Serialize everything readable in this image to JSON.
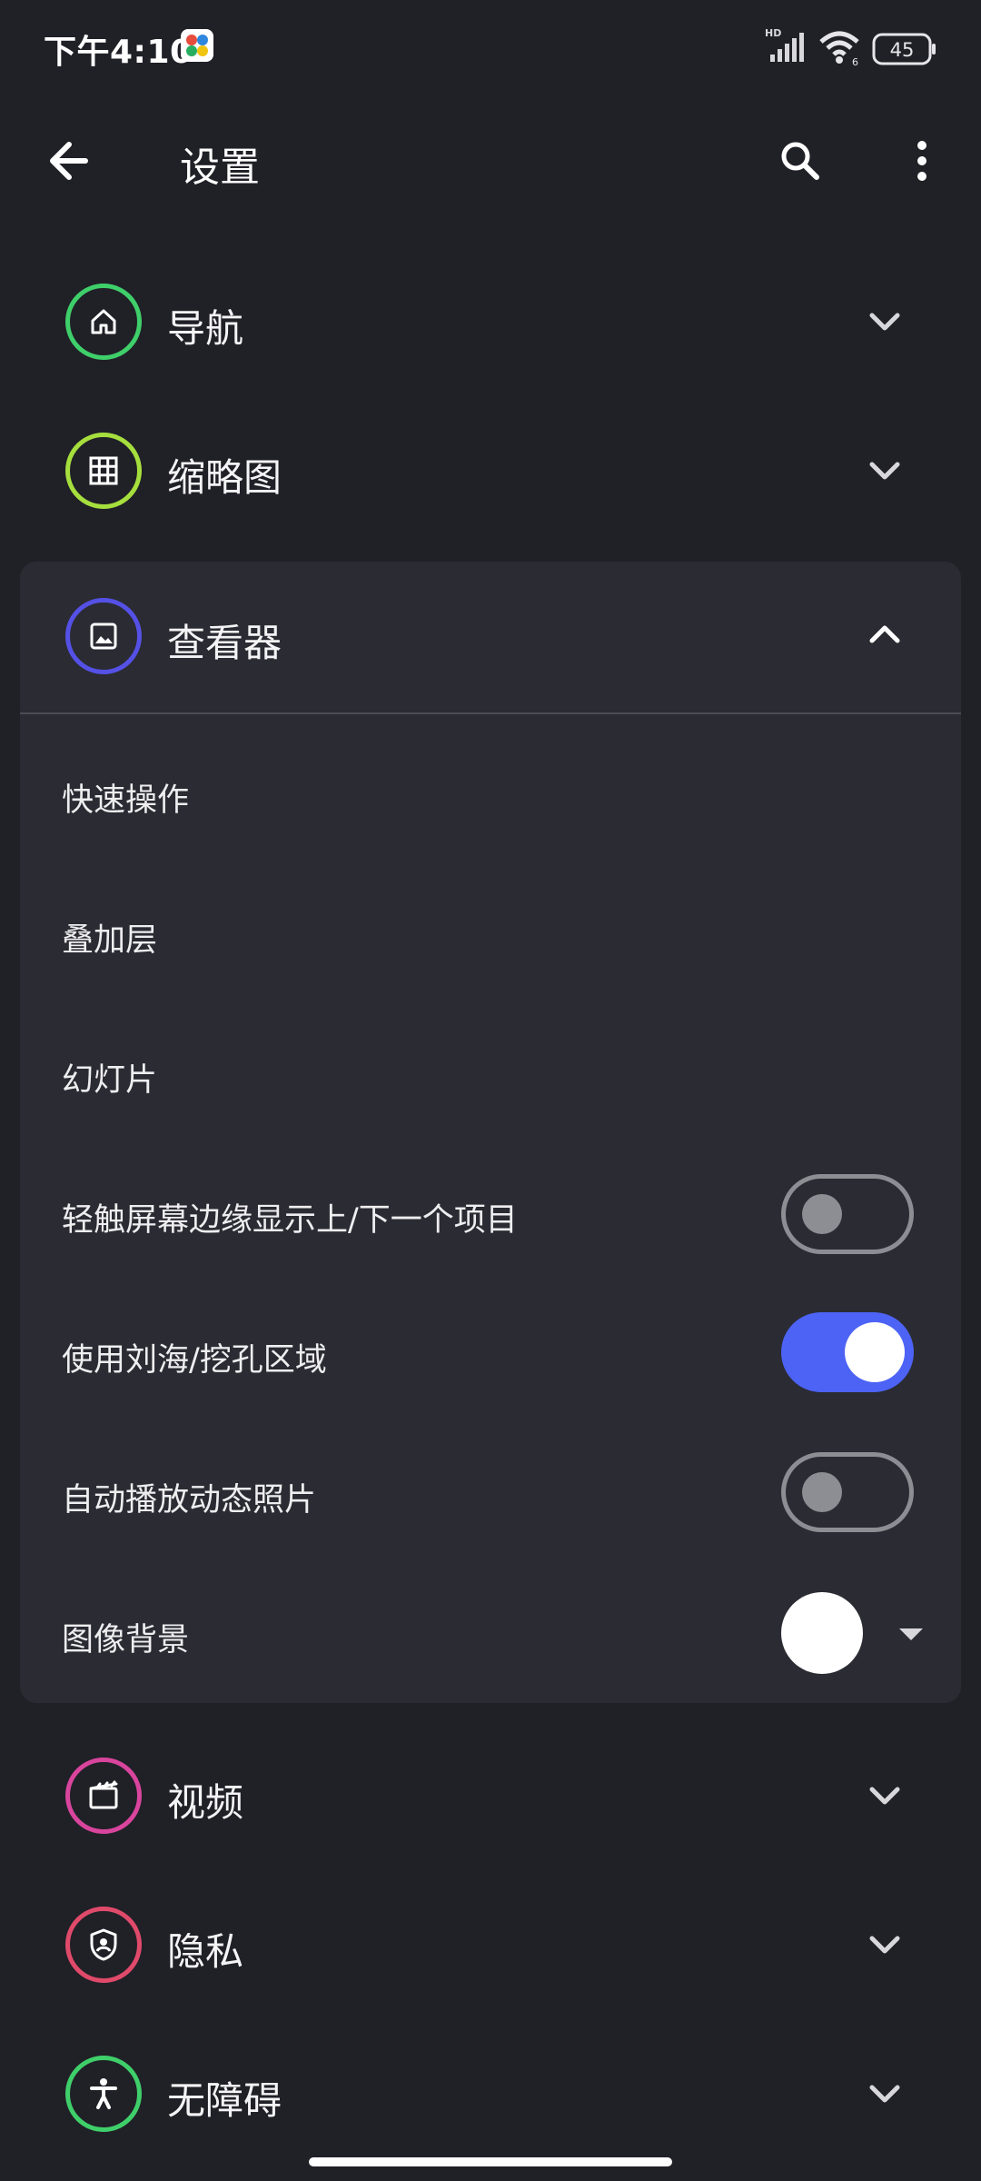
{
  "status_bar": {
    "time": "下午4:10",
    "network_label": "HD",
    "wifi_label": "6",
    "battery": "45"
  },
  "app_bar": {
    "title": "设置",
    "back_icon": "arrow-back-icon",
    "search_icon": "search-icon",
    "more_icon": "more-vert-icon"
  },
  "categories": [
    {
      "label": "导航",
      "icon": "home-icon",
      "color": "#3fcf6a",
      "expanded": false
    },
    {
      "label": "缩略图",
      "icon": "grid-icon",
      "color": "#a6df3d",
      "expanded": false
    },
    {
      "label": "查看器",
      "icon": "image-icon",
      "color": "#5551e6",
      "expanded": true
    },
    {
      "label": "视频",
      "icon": "movie-icon",
      "color": "#d9459d",
      "expanded": false
    },
    {
      "label": "隐私",
      "icon": "privacy-shield-icon",
      "color": "#e04a6a",
      "expanded": false
    },
    {
      "label": "无障碍",
      "icon": "accessibility-icon",
      "color": "#3fcf6a",
      "expanded": false
    }
  ],
  "viewer_settings": {
    "items": [
      {
        "label": "快速操作"
      },
      {
        "label": "叠加层"
      },
      {
        "label": "幻灯片"
      },
      {
        "label": "轻触屏幕边缘显示上/下一个项目",
        "toggle": false
      },
      {
        "label": "使用刘海/挖孔区域",
        "toggle": true
      },
      {
        "label": "自动播放动态照片",
        "toggle": false
      },
      {
        "label": "图像背景",
        "color": "#ffffff"
      }
    ]
  },
  "colors": {
    "background": "#202027",
    "card": "#2b2b33",
    "accent": "#4c63f5"
  }
}
